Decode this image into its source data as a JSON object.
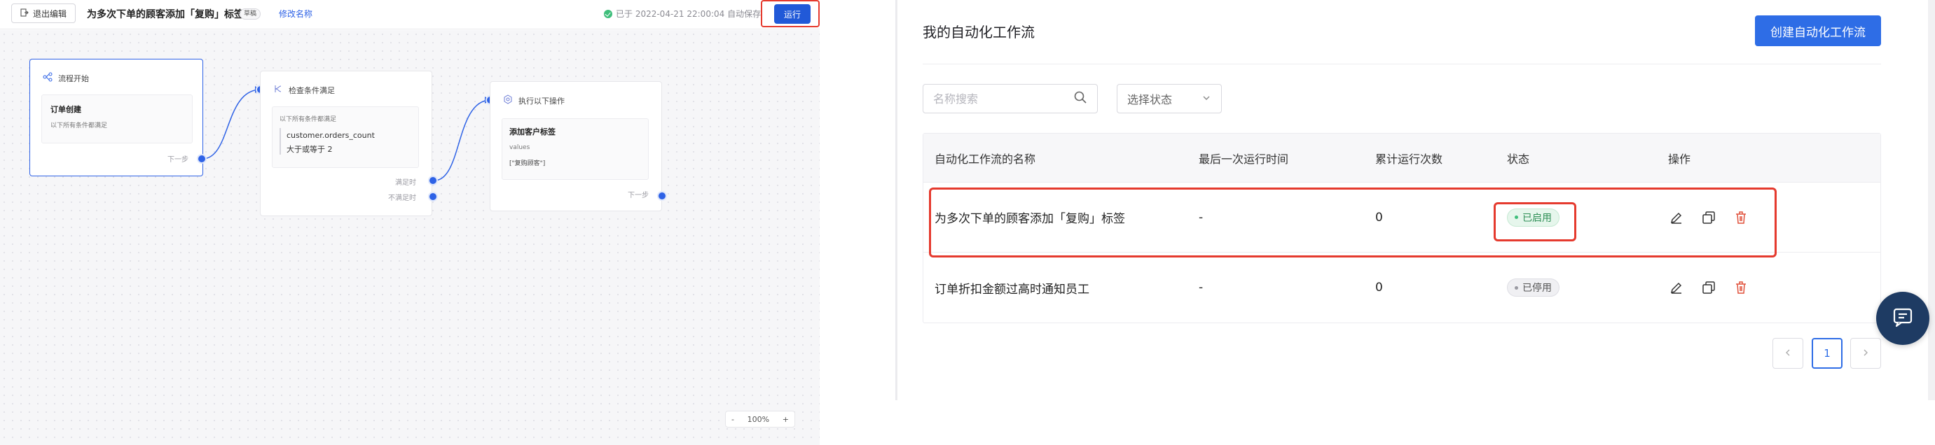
{
  "editor": {
    "exit_label": "退出编辑",
    "workflow_title": "为多次下单的顾客添加「复购」标签",
    "draft_badge": "草稿",
    "rename_label": "修改名称",
    "saved_status": "已于 2022-04-21 22:00:04 自动保存",
    "run_label": "运行",
    "zoom": {
      "minus": "-",
      "level": "100%",
      "plus": "+"
    },
    "nodes": {
      "start": {
        "header": "流程开始",
        "trigger_title": "订单创建",
        "trigger_sub": "以下所有条件都满足",
        "next_label": "下一步"
      },
      "condition": {
        "header": "检查条件满足",
        "group_label": "以下所有条件都满足",
        "field": "customer.orders_count",
        "operator_value": "大于或等于  2",
        "true_label": "满足时",
        "false_label": "不满足时"
      },
      "action": {
        "header": "执行以下操作",
        "action_title": "添加客户标签",
        "values_label": "values",
        "values_value": "[\"复购顾客\"]",
        "next_label": "下一步"
      }
    }
  },
  "list": {
    "page_title": "我的自动化工作流",
    "create_label": "创建自动化工作流",
    "search_placeholder": "名称搜索",
    "status_select": "选择状态",
    "columns": {
      "name": "自动化工作流的名称",
      "last_run": "最后一次运行时间",
      "run_count": "累计运行次数",
      "status": "状态",
      "ops": "操作"
    },
    "rows": [
      {
        "name": "为多次下单的顾客添加「复购」标签",
        "last_run": "-",
        "run_count": "0",
        "status": "已启用"
      },
      {
        "name": "订单折扣金额过高时通知员工",
        "last_run": "-",
        "run_count": "0",
        "status": "已停用"
      }
    ],
    "pagination": {
      "current": "1"
    }
  },
  "colors": {
    "primary": "#2e6de6",
    "highlight": "#e53a2e",
    "enabled": "#3fbe7b",
    "chat_fab": "#1e3b63"
  }
}
